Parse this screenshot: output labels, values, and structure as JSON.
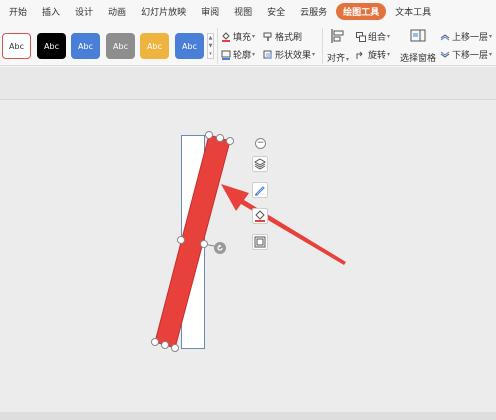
{
  "menu": {
    "tabs": [
      "开始",
      "插入",
      "设计",
      "动画",
      "幻灯片放映",
      "审阅",
      "视图",
      "安全",
      "云服务",
      "绘图工具",
      "文本工具"
    ],
    "active_tab": "绘图工具"
  },
  "ribbon": {
    "style_swatches": [
      {
        "label": "Abc",
        "fill": "#ffffff",
        "text": "#333333",
        "border": "#d9534f"
      },
      {
        "label": "Abc",
        "fill": "#000000",
        "text": "#ffffff"
      },
      {
        "label": "Abc",
        "fill": "#4a7fd8",
        "text": "#ffffff"
      },
      {
        "label": "Abc",
        "fill": "#8e8e8e",
        "text": "#ffffff"
      },
      {
        "label": "Abc",
        "fill": "#efb340",
        "text": "#ffffff"
      },
      {
        "label": "Abc",
        "fill": "#4a7fd8",
        "text": "#ffffff"
      }
    ],
    "fill_label": "填充",
    "format_painter_label": "格式刷",
    "outline_label": "轮廓",
    "shape_effects_label": "形状效果",
    "align_label": "对齐",
    "group_label": "组合",
    "rotate_label": "旋转",
    "selection_pane_label": "选择窗格",
    "bring_forward_label": "上移一层",
    "send_backward_label": "下移一层"
  },
  "canvas": {
    "shape_fill": "#e8403b",
    "arrow_color": "#e8403b",
    "accent_color": "#e2733f"
  }
}
